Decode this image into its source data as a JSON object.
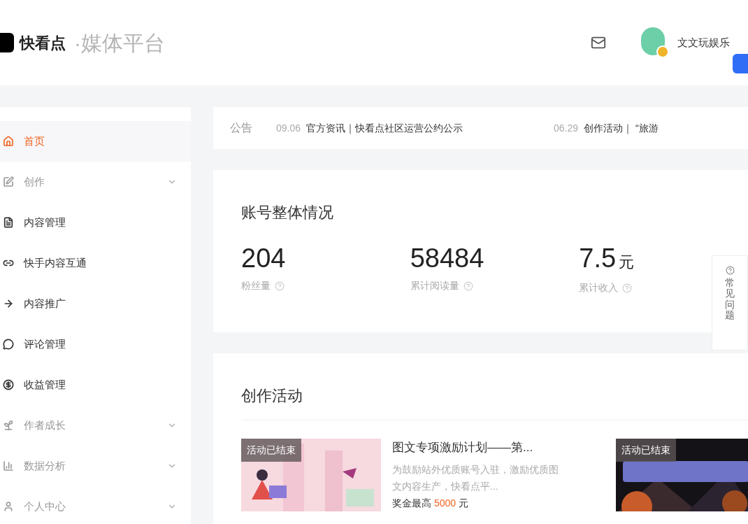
{
  "header": {
    "brand": "快看点",
    "subtitle": "·媒体平台",
    "user_name": "文文玩娱乐"
  },
  "sidebar": {
    "items": [
      {
        "label": "首页",
        "selected": true,
        "expandable": false,
        "muted": false
      },
      {
        "label": "创作",
        "selected": false,
        "expandable": true,
        "muted": true
      },
      {
        "label": "内容管理",
        "selected": false,
        "expandable": false,
        "muted": false
      },
      {
        "label": "快手内容互通",
        "selected": false,
        "expandable": false,
        "muted": false
      },
      {
        "label": "内容推广",
        "selected": false,
        "expandable": false,
        "muted": false
      },
      {
        "label": "评论管理",
        "selected": false,
        "expandable": false,
        "muted": false
      },
      {
        "label": "收益管理",
        "selected": false,
        "expandable": false,
        "muted": false
      },
      {
        "label": "作者成长",
        "selected": false,
        "expandable": true,
        "muted": true
      },
      {
        "label": "数据分析",
        "selected": false,
        "expandable": true,
        "muted": true
      },
      {
        "label": "个人中心",
        "selected": false,
        "expandable": true,
        "muted": true
      }
    ]
  },
  "notice": {
    "label": "公告",
    "items": [
      {
        "date": "09.06",
        "text": "官方资讯｜快看点社区运营公约公示"
      },
      {
        "date": "06.29",
        "text": "创作活动｜ “旅游"
      }
    ]
  },
  "overview": {
    "title": "账号整体情况",
    "stats": [
      {
        "value": "204",
        "label": "粉丝量"
      },
      {
        "value": "58484",
        "label": "累计阅读量"
      },
      {
        "value": "7.5",
        "unit": "元",
        "label": "累计收入"
      }
    ]
  },
  "help_tab": {
    "label": "常见问题"
  },
  "activities": {
    "title": "创作活动",
    "cards": [
      {
        "badge": "活动已结束",
        "title": "图文专项激励计划——第...",
        "description": "为鼓励站外优质账号入驻，激励优质图文内容生产，快看点平...",
        "bonus_label": "奖金最高",
        "bonus_value": "5000",
        "bonus_unit": "元"
      },
      {
        "badge": "活动已结束"
      }
    ]
  }
}
